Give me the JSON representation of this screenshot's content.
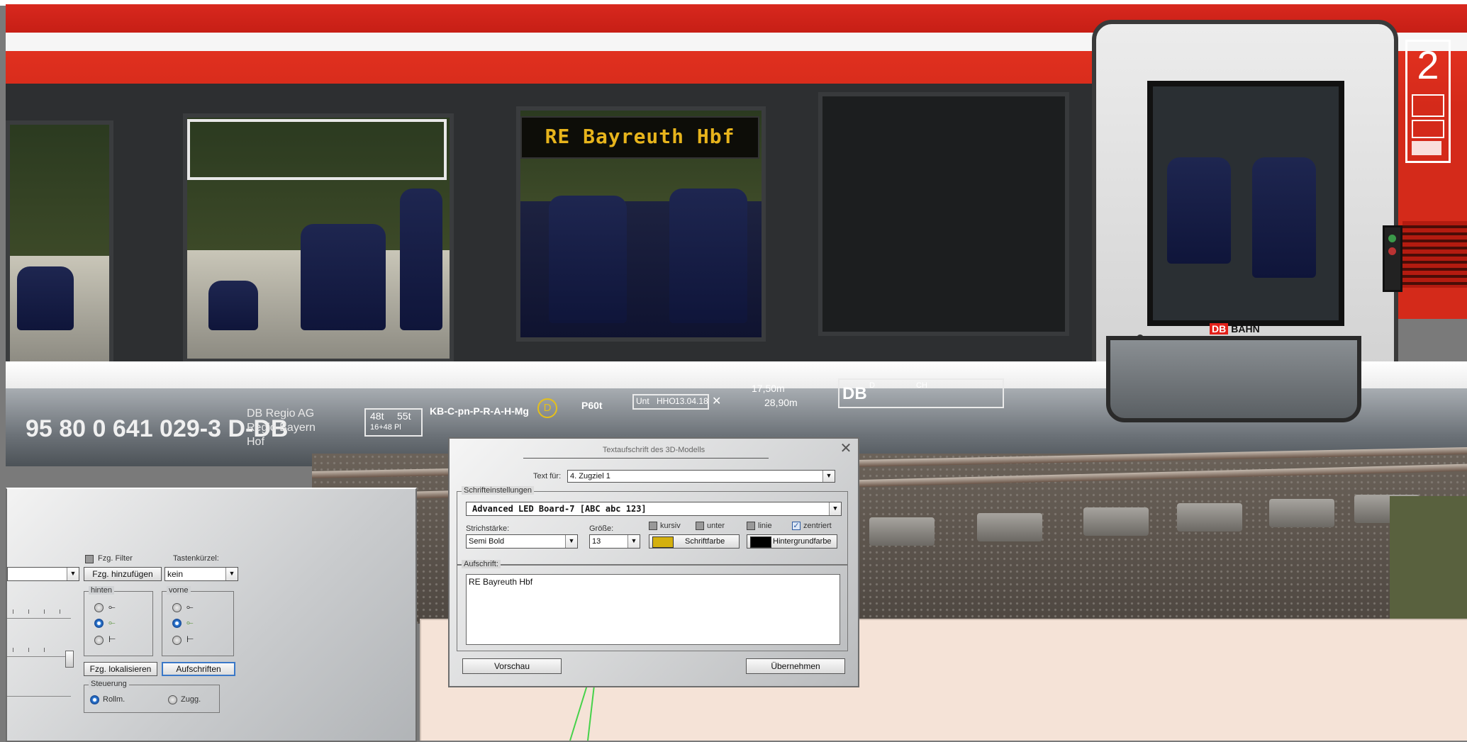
{
  "train": {
    "destination_display": "RE Bayreuth Hbf",
    "class_number": "2",
    "registration": "95 80 0 641 029-3 D-DB",
    "operator_lines": [
      "DB Regio AG",
      "Regio Bayern",
      "Hof"
    ],
    "weight_marks": [
      "48t",
      "55t",
      "16+48 Pl"
    ],
    "brake_code": "KB-C-pn-P-R-A-H-Mg",
    "d_badge": "D",
    "p_mark": "P60t",
    "unt_mark": "Unt",
    "unt_code": "HHO",
    "unt_date": "13.04.18",
    "length_1": "17,50m",
    "length_2": "28,90m",
    "db_mark": "DB",
    "db_d": "D",
    "db_ch": "CH",
    "door_logo_db": "DB",
    "door_logo_bahn": "BAHN"
  },
  "left_panel": {
    "vehicle_filter_label": "Fzg. Filter",
    "hotkey_label": "Tastenkürzel:",
    "add_vehicle_button": "Fzg. hinzufügen",
    "hotkey_value": "kein",
    "rear_group": "hinten",
    "front_group": "vorne",
    "locate_button": "Fzg. lokalisieren",
    "labels_button": "Aufschriften",
    "control_group": "Steuerung",
    "rolling_label": "Rollm.",
    "towing_label": "Zugg."
  },
  "dialog": {
    "title": "Textaufschrift des 3D-Modells",
    "text_for_label": "Text für:",
    "text_for_value": "4. Zugziel 1",
    "font_group": "Schrifteinstellungen",
    "font_value": "Advanced LED Board-7 [ABC abc 123]",
    "stroke_label": "Strichstärke:",
    "stroke_value": "Semi Bold",
    "size_label": "Größe:",
    "size_value": "13",
    "italic_label": "kursiv",
    "underline_label": "unter",
    "line_label": "linie",
    "centered_label": "zentriert",
    "text_color_button": "Schriftfarbe",
    "background_color_button": "Hintergrundfarbe",
    "text_color": "#d4b00e",
    "background_color": "#000000",
    "caption_group": "Aufschrift:",
    "caption_text": "RE Bayreuth Hbf",
    "preview_button": "Vorschau",
    "apply_button": "Übernehmen"
  },
  "colors": {
    "train_red": "#d42a1a",
    "led_amber": "#e7b41c",
    "selection_blue": "#2d7bd8"
  }
}
